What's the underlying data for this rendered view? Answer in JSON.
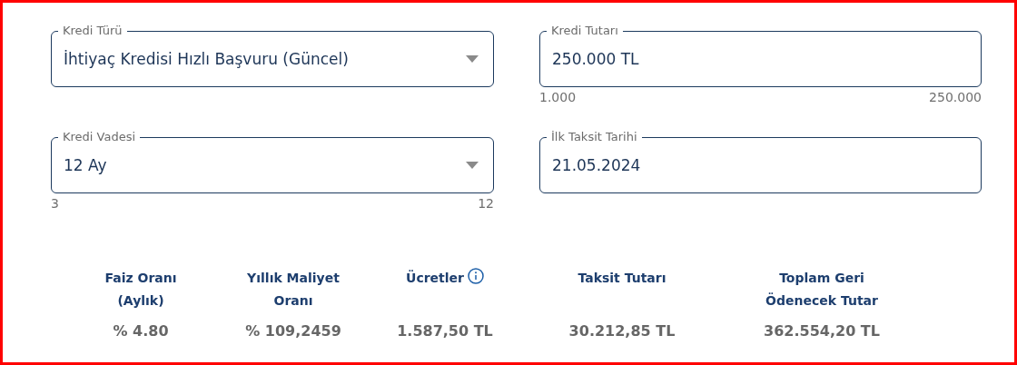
{
  "fields": [
    {
      "kind": "select",
      "label": "Kredi Türü",
      "value": "İhtiyaç Kredisi Hızlı Başvuru (Güncel)"
    },
    {
      "kind": "input",
      "label": "Kredi Tutarı",
      "value": "250.000 TL",
      "min": "1.000",
      "max": "250.000"
    },
    {
      "kind": "select",
      "label": "Kredi Vadesi",
      "value": "12 Ay",
      "min": "3",
      "max": "12"
    },
    {
      "kind": "input",
      "label": "İlk Taksit Tarihi",
      "value": "21.05.2024"
    }
  ],
  "summary": [
    {
      "heading": "Faiz Oranı\n(Aylık)",
      "value": "% 4.80",
      "info": false
    },
    {
      "heading": "Yıllık Maliyet\nOranı",
      "value": "% 109,2459",
      "info": false
    },
    {
      "heading": "Ücretler",
      "value": "1.587,50 TL",
      "info": true
    },
    {
      "heading": "Taksit Tutarı",
      "value": "30.212,85 TL",
      "info": false
    },
    {
      "heading": "Toplam Geri\nÖdenecek Tutar",
      "value": "362.554,20 TL",
      "info": false
    }
  ]
}
